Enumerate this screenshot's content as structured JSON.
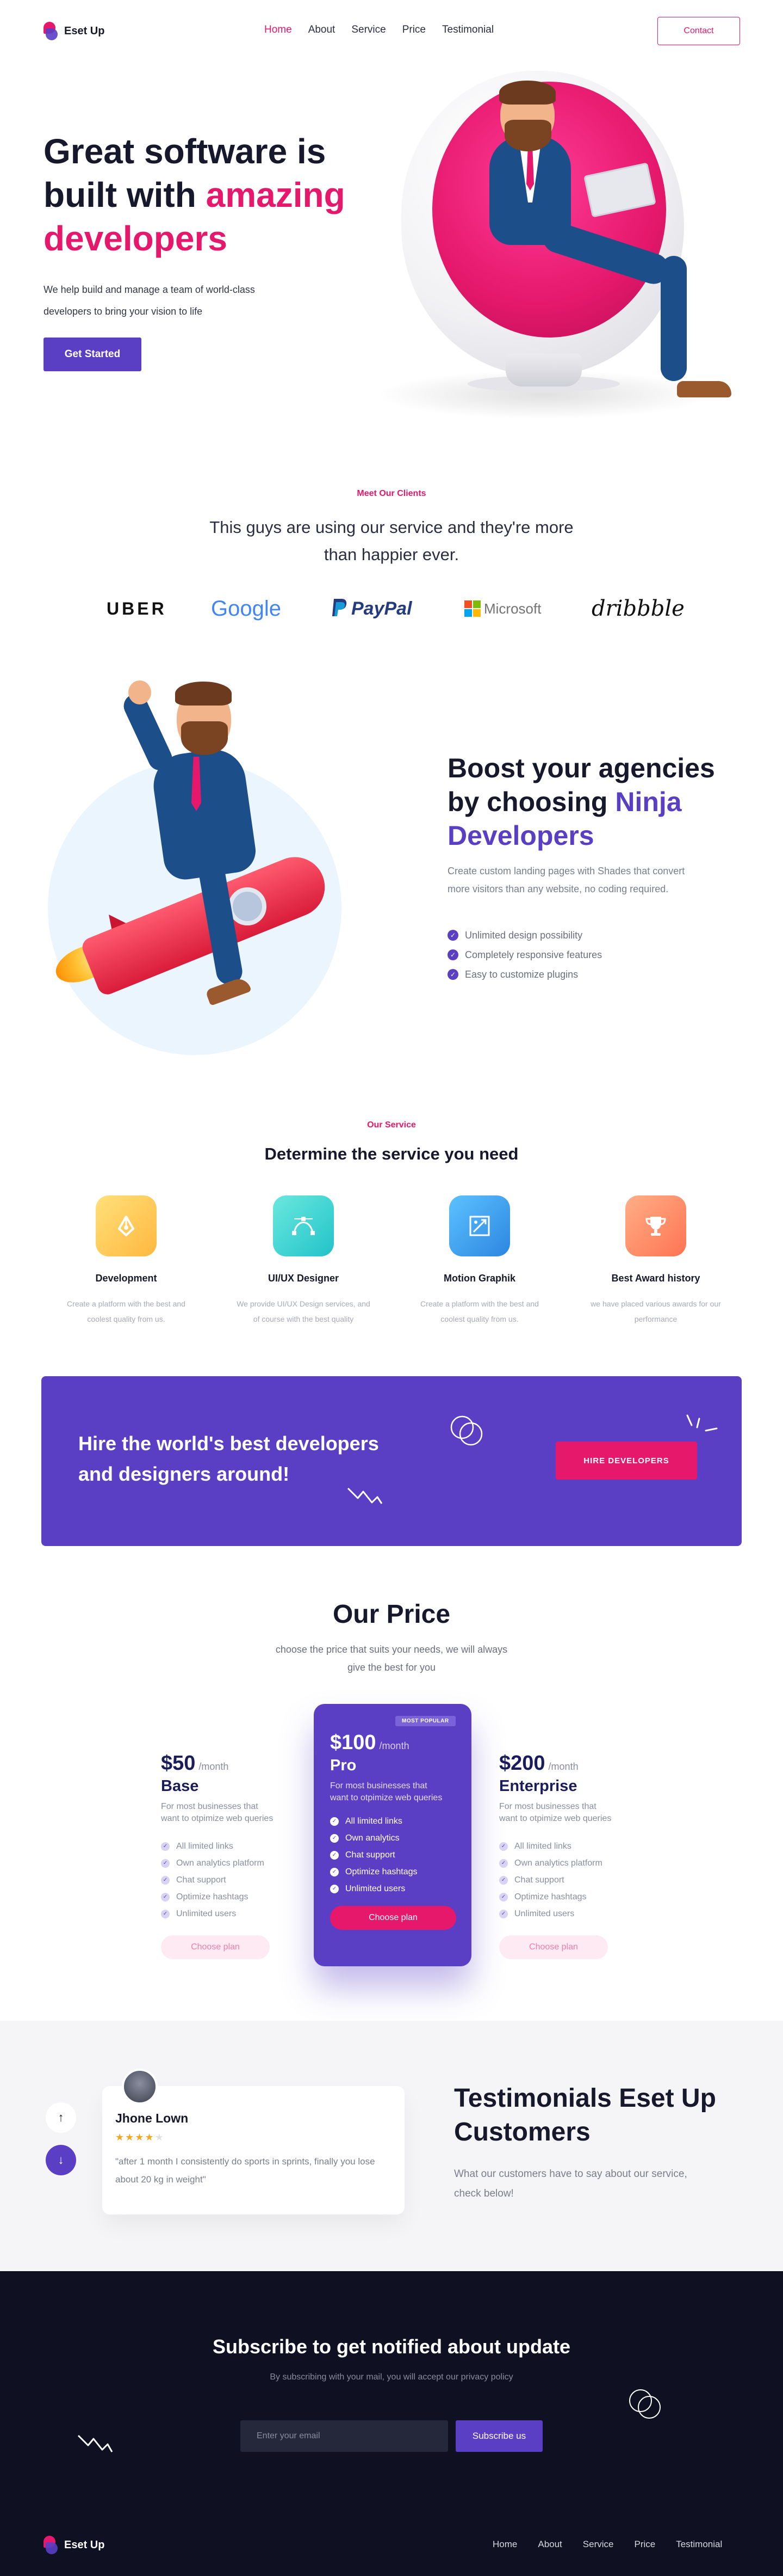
{
  "brand": {
    "name": "Eset Up"
  },
  "nav": {
    "items": [
      "Home",
      "About",
      "Service",
      "Price",
      "Testimonial"
    ],
    "contact": "Contact"
  },
  "hero": {
    "title_line1": "Great software is",
    "title_line2_plain": "built with ",
    "title_line2_accent": "amazing",
    "title_line3_accent": "developers",
    "desc": "We help build and manage a team of world-class developers to bring your vision to life",
    "cta": "Get Started"
  },
  "clients": {
    "eyebrow": "Meet Our Clients",
    "title": "This guys are using our service and they're more than happier ever.",
    "logos": [
      "UBER",
      "Google",
      "PayPal",
      "Microsoft",
      "dribbble"
    ]
  },
  "boost": {
    "title_plain": "Boost your agencies by choosing ",
    "title_accent": "Ninja Developers",
    "desc": "Create custom landing pages with Shades that convert more visitors than any website, no coding required.",
    "features": [
      "Unlimited design possibility",
      "Completely responsive features",
      "Easy to customize plugins"
    ]
  },
  "service": {
    "eyebrow": "Our Service",
    "title": "Determine the service you need",
    "items": [
      {
        "name": "Development",
        "desc": "Create a platform with the best and coolest quality from us.",
        "icon": "pen-tool-icon",
        "color": "#ffcb5c"
      },
      {
        "name": "UI/UX Designer",
        "desc": "We provide UI/UX Design services, and of course with the best quality",
        "icon": "bezier-curve-icon",
        "color": "#40d6d1"
      },
      {
        "name": "Motion Graphik",
        "desc": "Create a platform with the best and coolest quality from us.",
        "icon": "motion-frame-icon",
        "color": "#3aa3ec"
      },
      {
        "name": "Best Award history",
        "desc": "we have placed various awards for our performance",
        "icon": "trophy-icon",
        "color": "#ff8c69"
      }
    ]
  },
  "hire": {
    "text": "Hire the world's best developers and designers around!",
    "button": "HIRE DEVELOPERS"
  },
  "pricing": {
    "title": "Our Price",
    "subtitle": "choose the price that suits your needs, we will always give the best for you",
    "plans": [
      {
        "price": "$50",
        "period": "/month",
        "name": "Base",
        "desc": "For most businesses that want to otpimize web queries",
        "features": [
          "All limited links",
          "Own analytics platform",
          "Chat support",
          "Optimize hashtags",
          "Unlimited users"
        ],
        "button": "Choose plan"
      },
      {
        "price": "$100",
        "period": "/month",
        "name": "Pro",
        "badge": "MOST POPULAR",
        "desc": "For most businesses that want to otpimize web queries",
        "features": [
          "All limited links",
          "Own analytics",
          "Chat support",
          "Optimize hashtags",
          "Unlimited users"
        ],
        "button": "Choose plan"
      },
      {
        "price": "$200",
        "period": "/month",
        "name": "Enterprise",
        "desc": "For most businesses that want to otpimize web queries",
        "features": [
          "All limited links",
          "Own analytics platform",
          "Chat support",
          "Optimize hashtags",
          "Unlimited users"
        ],
        "button": "Choose plan"
      }
    ]
  },
  "testimonials": {
    "title": "Testimonials Eset Up Customers",
    "desc": "What our customers have to say about our service, check below!",
    "card": {
      "name": "Jhone Lown",
      "rating": 4,
      "quote": "\"after 1 month I consistently do sports in sprints, finally you lose about 20 kg in weight\""
    }
  },
  "subscribe": {
    "title": "Subscribe to get notified about update",
    "desc": "By subscribing with your mail, you will accept our privacy policy",
    "placeholder": "Enter your email",
    "button": "Subscribe us"
  },
  "footer": {
    "items": [
      "Home",
      "About",
      "Service",
      "Price",
      "Testimonial"
    ]
  },
  "colors": {
    "primary": "#5a3fc5",
    "accent": "#e5186c",
    "dark": "#0f1021"
  }
}
